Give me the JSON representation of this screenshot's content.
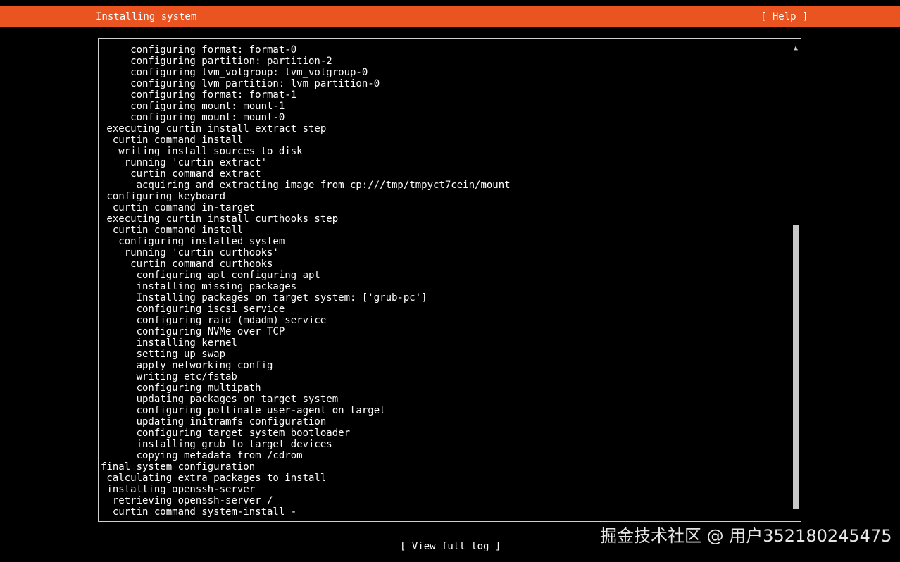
{
  "header": {
    "title": "Installing system",
    "help_label": "[ Help ]"
  },
  "colors": {
    "header_bg": "#e95420",
    "background": "#000000",
    "text": "#ffffff"
  },
  "log": {
    "lines": [
      "     configuring format: format-0",
      "     configuring partition: partition-2",
      "     configuring lvm_volgroup: lvm_volgroup-0",
      "     configuring lvm_partition: lvm_partition-0",
      "     configuring format: format-1",
      "     configuring mount: mount-1",
      "     configuring mount: mount-0",
      " executing curtin install extract step",
      "  curtin command install",
      "   writing install sources to disk",
      "    running 'curtin extract'",
      "     curtin command extract",
      "      acquiring and extracting image from cp:///tmp/tmpyct7cein/mount",
      " configuring keyboard",
      "  curtin command in-target",
      " executing curtin install curthooks step",
      "  curtin command install",
      "   configuring installed system",
      "    running 'curtin curthooks'",
      "     curtin command curthooks",
      "      configuring apt configuring apt",
      "      installing missing packages",
      "      Installing packages on target system: ['grub-pc']",
      "      configuring iscsi service",
      "      configuring raid (mdadm) service",
      "      configuring NVMe over TCP",
      "      installing kernel",
      "      setting up swap",
      "      apply networking config",
      "      writing etc/fstab",
      "      configuring multipath",
      "      updating packages on target system",
      "      configuring pollinate user-agent on target",
      "      updating initramfs configuration",
      "      configuring target system bootloader",
      "      installing grub to target devices",
      "      copying metadata from /cdrom",
      "final system configuration",
      " calculating extra packages to install",
      " installing openssh-server",
      "  retrieving openssh-server /",
      "  curtin command system-install -"
    ]
  },
  "scrollbar": {
    "up_icon": "▲"
  },
  "footer": {
    "view_log_label": "[ View full log ]"
  },
  "watermark": {
    "text": "掘金技术社区 @ 用户352180245475"
  }
}
